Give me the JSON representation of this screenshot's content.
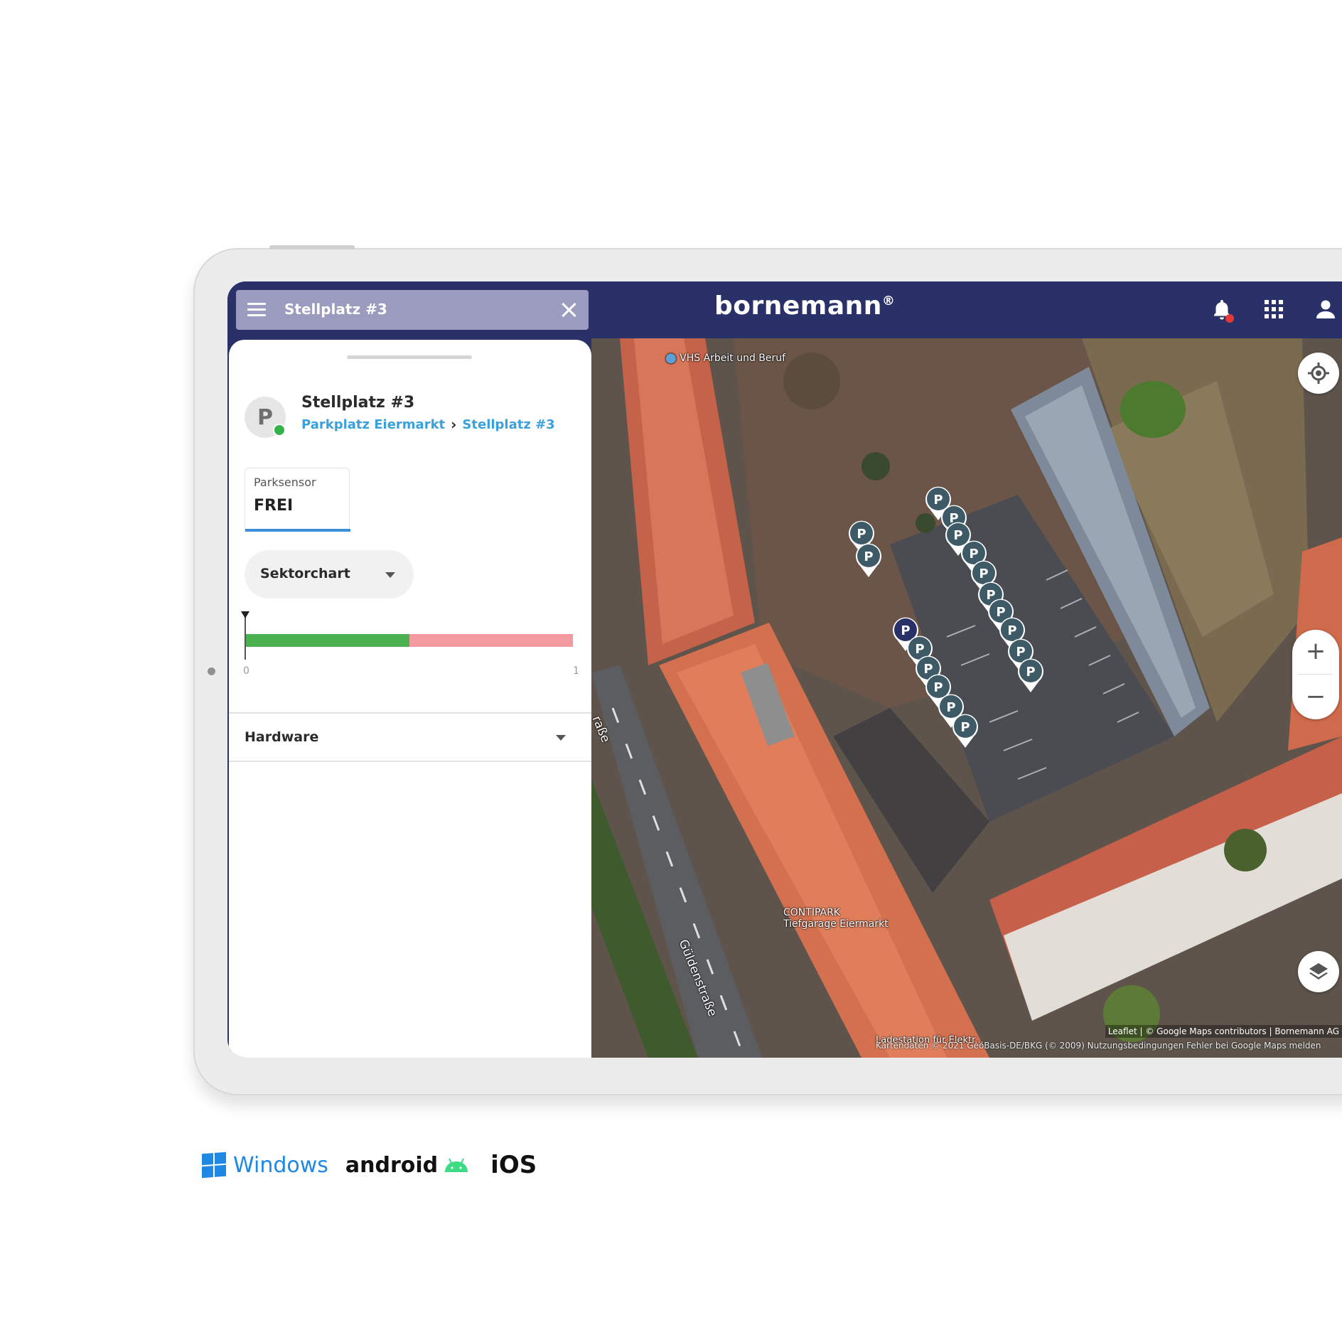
{
  "header": {
    "search_value": "Stellplatz #3",
    "brand": "bornemann",
    "brand_mark": "®"
  },
  "panel": {
    "avatar_letter": "P",
    "title": "Stellplatz #3",
    "breadcrumb": [
      "Parkplatz Eiermarkt",
      "Stellplatz #3"
    ],
    "sensor": {
      "label": "Parksensor",
      "value": "FREI"
    },
    "chart_select": "Sektorchart",
    "sector_bar": {
      "min_label": "0",
      "max_label": "1",
      "green_fraction": 0.5
    },
    "hardware_label": "Hardware"
  },
  "map": {
    "labels": {
      "vhs": "VHS Arbeit und Beruf",
      "contipark_1": "CONTIPARK",
      "contipark_2": "Tiefgarage Eiermarkt",
      "street_left": "raße",
      "street_main": "Güldenstraße",
      "ladestation": "Ladestation für Elektr...",
      "pin_letter": "P"
    },
    "attribution": "Leaflet | © Google Maps contributors | Bornemann AG",
    "attribution_2": "Kartendaten © 2021 GeoBasis-DE/BKG (© 2009)   Nutzungsbedingungen   Fehler bei Google Maps melden",
    "zoom_in": "+",
    "zoom_out": "−"
  },
  "platforms": {
    "windows": "Windows",
    "android": "android",
    "ios": "iOS"
  },
  "colors": {
    "header": "#2a3168",
    "accent": "#3aa0dc",
    "status_green": "#34b34a",
    "pin": "#3d5a66",
    "pin_selected": "#2a3168"
  },
  "icons": [
    "menu-icon",
    "close-icon",
    "bell-icon",
    "apps-grid-icon",
    "user-icon",
    "locate-icon",
    "layers-icon",
    "windows-logo-icon",
    "android-logo-icon"
  ]
}
